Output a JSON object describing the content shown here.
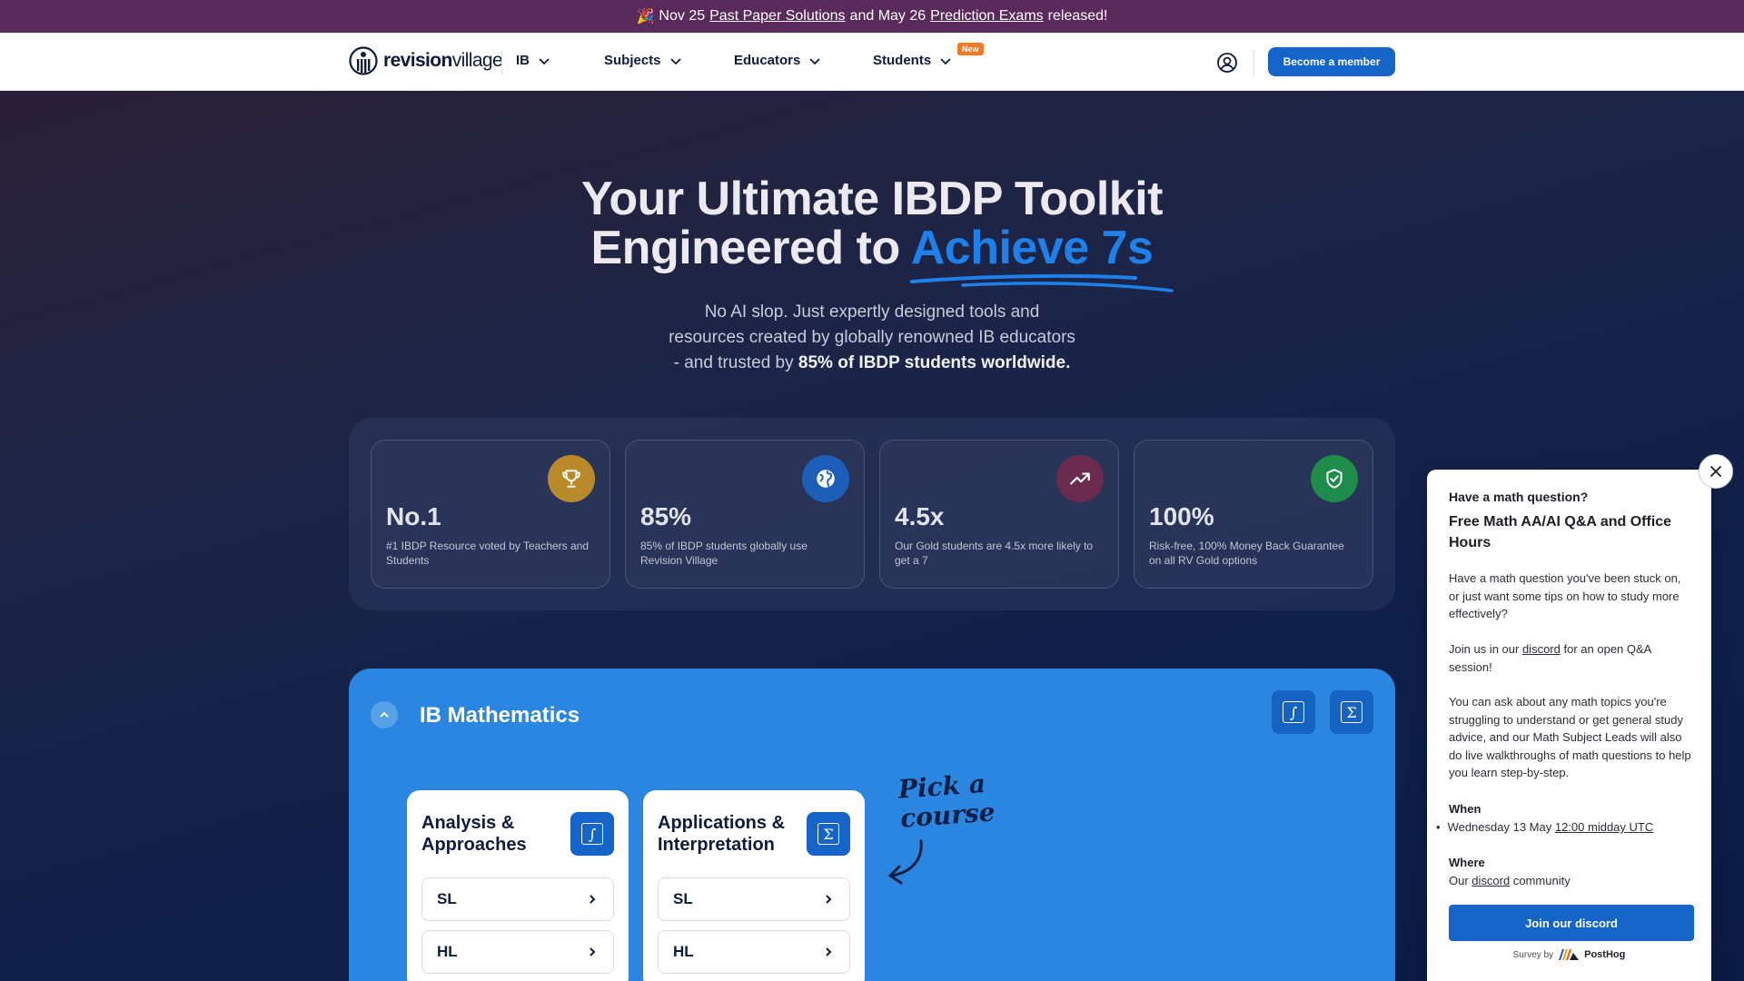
{
  "announcement": {
    "emoji": "🎉",
    "prefix": "Nov 25",
    "link1": "Past Paper Solutions",
    "middle": "and May 26",
    "link2": "Prediction Exams",
    "suffix": "released!"
  },
  "nav": {
    "logo_bold": "revision",
    "logo_light": "village",
    "items": [
      "IB",
      "Subjects",
      "Educators",
      "Students"
    ],
    "new_badge": "New",
    "member_button": "Become a member"
  },
  "hero": {
    "title_line1": "Your Ultimate IBDP Toolkit",
    "title_line2_plain": "Engineered to",
    "title_line2_accent": "Achieve 7s",
    "sub_line1": "No AI slop. Just expertly designed tools and",
    "sub_line2": "resources created by globally renowned IB educators",
    "sub_line3_plain": "- and trusted by",
    "sub_line3_bold": "85% of IBDP students worldwide."
  },
  "stats": [
    {
      "value": "No.1",
      "desc": "#1 IBDP Resource voted by Teachers and Students",
      "icon": "trophy-icon",
      "color": "#b98a2a"
    },
    {
      "value": "85%",
      "desc": "85% of IBDP students globally use Revision Village",
      "icon": "globe-icon",
      "color": "#1d5fb8"
    },
    {
      "value": "4.5x",
      "desc": "Our Gold students are 4.5x more likely to get a 7",
      "icon": "trend-up-icon",
      "color": "#6b2b4f"
    },
    {
      "value": "100%",
      "desc": "Risk-free, 100% Money Back Guarantee on all RV Gold options",
      "icon": "shield-check-icon",
      "color": "#1e8c4a"
    }
  ],
  "math_panel": {
    "title": "IB Mathematics",
    "symbol_integral": "∫",
    "symbol_sigma": "Σ",
    "courses": [
      {
        "title_line1": "Analysis &",
        "title_line2": "Approaches",
        "symbol": "∫",
        "levels": [
          "SL",
          "HL"
        ]
      },
      {
        "title_line1": "Applications &",
        "title_line2": "Interpretation",
        "symbol": "Σ",
        "levels": [
          "SL",
          "HL"
        ]
      }
    ],
    "pick_line1": "Pick a",
    "pick_line2": "course"
  },
  "survey": {
    "question": "Have a math question?",
    "title": "Free Math AA/AI Q&A and Office Hours",
    "p1": "Have a math question you've been stuck on, or just want some tips on how to study more effectively?",
    "p2_before": "Join us in our",
    "p2_link": "discord",
    "p2_after": "for an open Q&A session!",
    "p3": "You can ask about any math topics you're struggling to understand or get general study advice, and our Math Subject Leads will also do live walkthroughs of math questions to help you learn step-by-step.",
    "when_label": "When",
    "when_prefix": "Wednesday 13 May",
    "when_link": "12:00 midday UTC",
    "where_label": "Where",
    "where_before": "Our",
    "where_link": "discord",
    "where_after": "community",
    "button": "Join our discord",
    "footer_prefix": "Survey by",
    "footer_brand": "PostHog"
  }
}
